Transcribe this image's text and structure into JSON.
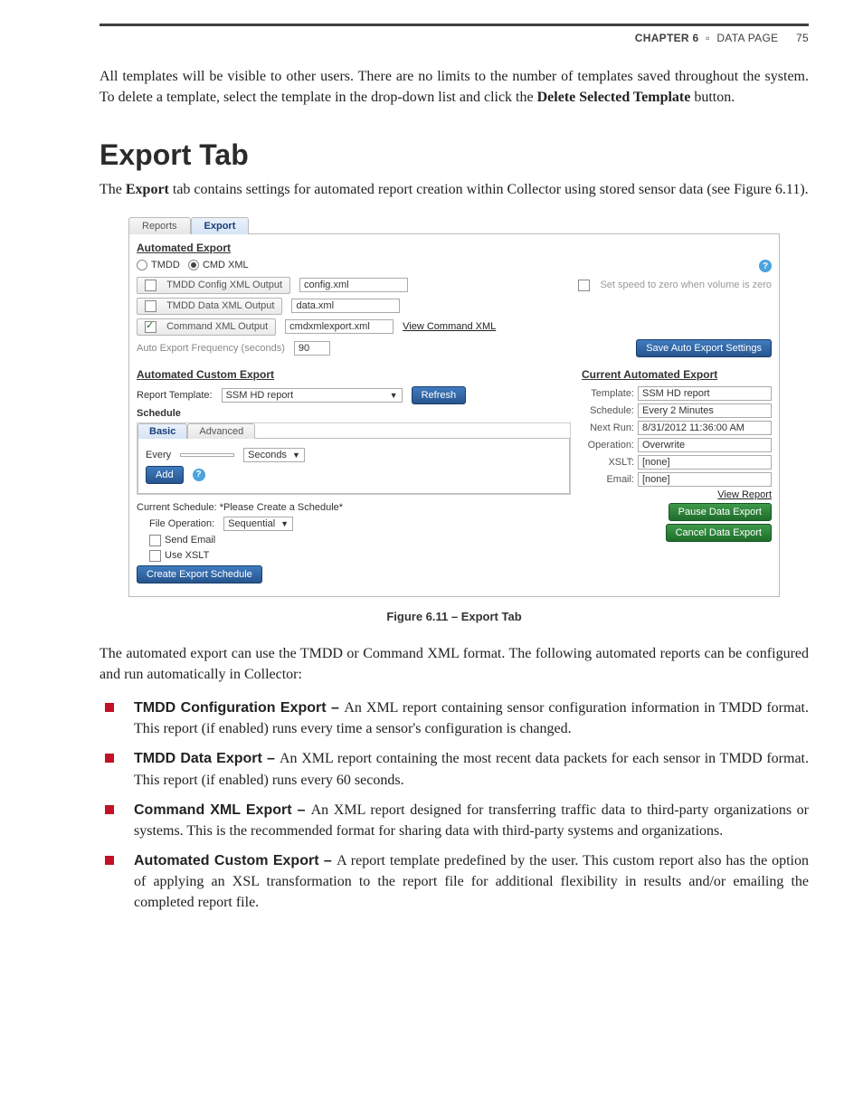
{
  "header": {
    "chapter_label": "CHAPTER 6",
    "section_label": "DATA PAGE",
    "page_number": "75"
  },
  "intro_para": "All templates will be visible to other users. There are no limits to the number of templates saved throughout the system. To delete a template, select the template in the drop-down list and click the Delete Selected Template button.",
  "intro_bold_phrase": "Delete Selected Template",
  "h1": "Export Tab",
  "h1_para_a": "The ",
  "h1_para_bold": "Export",
  "h1_para_b": " tab contains settings for automated report creation within Collector using stored sensor data (see Figure 6.11).",
  "ui": {
    "tabs": {
      "reports": "Reports",
      "export": "Export"
    },
    "auto_export_title": "Automated Export",
    "radio_tmdd": "TMDD",
    "radio_cmdxml": "CMD XML",
    "tmdd_config": {
      "label": "TMDD Config XML Output",
      "value": "config.xml"
    },
    "tmdd_data": {
      "label": "TMDD Data XML Output",
      "value": "data.xml"
    },
    "cmd_xml": {
      "label": "Command XML Output",
      "value": "cmdxmlexport.xml",
      "link": "View Command XML"
    },
    "set_speed": "Set speed to zero when volume is zero",
    "freq_label": "Auto Export Frequency (seconds)",
    "freq_value": "90",
    "save_btn": "Save Auto Export Settings",
    "custom_title": "Automated Custom Export",
    "current_title": "Current Automated Export",
    "report_template_label": "Report Template:",
    "report_template_value": "SSM HD report",
    "refresh": "Refresh",
    "schedule_title": "Schedule",
    "inner_tabs": {
      "basic": "Basic",
      "advanced": "Advanced"
    },
    "every_label": "Every",
    "every_unit": "Seconds",
    "add_btn": "Add",
    "cur_sched": "Current Schedule: *Please Create a Schedule*",
    "file_op_label": "File Operation:",
    "file_op_value": "Sequential",
    "send_email": "Send Email",
    "use_xslt": "Use XSLT",
    "create_btn": "Create Export Schedule",
    "cur": {
      "template_k": "Template:",
      "template_v": "SSM HD report",
      "schedule_k": "Schedule:",
      "schedule_v": "Every 2 Minutes",
      "nextrun_k": "Next Run:",
      "nextrun_v": "8/31/2012 11:36:00 AM",
      "operation_k": "Operation:",
      "operation_v": "Overwrite",
      "xslt_k": "XSLT:",
      "xslt_v": "[none]",
      "email_k": "Email:",
      "email_v": "[none]",
      "view_report": "View Report",
      "pause": "Pause Data Export",
      "cancel": "Cancel Data Export"
    }
  },
  "figure_caption": "Figure 6.11 – Export Tab",
  "post_para": "The automated export can use the TMDD or Command XML format. The following automated reports can be configured and run automatically in Collector:",
  "bullets": [
    {
      "title": "TMDD Configuration Export – ",
      "body": "An XML report containing sensor configuration information in TMDD format. This report (if enabled) runs every time a sensor's configuration is changed."
    },
    {
      "title": "TMDD Data Export – ",
      "body": "An XML report containing the most recent data packets for each sensor in TMDD format. This report (if enabled) runs every 60 seconds."
    },
    {
      "title": "Command XML Export – ",
      "body": "An XML report designed for transferring traffic data to third-party organizations or systems. This is the recommended format for sharing data with third-party systems and organizations."
    },
    {
      "title": "Automated Custom Export – ",
      "body": "A report template predefined by the user. This custom report also has the option of applying an XSL transformation to the report file for additional flexibility in results and/or emailing the completed report file."
    }
  ]
}
